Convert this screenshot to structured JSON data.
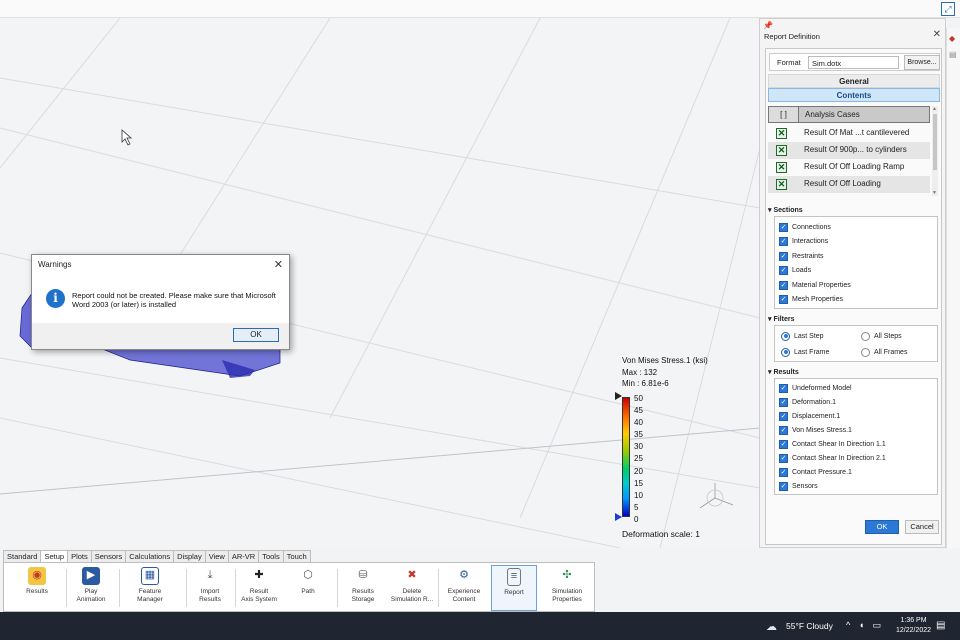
{
  "viewport": {
    "legend": {
      "title": "Von Mises Stress.1 (ksi)",
      "max_label": "Max : 132",
      "min_label": "Min : 6.81e-6",
      "ticks": [
        "50",
        "45",
        "40",
        "35",
        "30",
        "25",
        "20",
        "15",
        "10",
        "5",
        "0"
      ],
      "deformation_scale": "Deformation scale: 1"
    }
  },
  "dialog": {
    "title": "Warnings",
    "message": "Report could not be created. Please make sure that Microsoft Word 2003 (or later) is installed",
    "ok_label": "OK",
    "close_glyph": "✕"
  },
  "panel": {
    "title": "Report Definition",
    "close_glyph": "✕",
    "format_label": "Format",
    "format_value": "Sim.dotx",
    "browse_label": "Browse...",
    "general_label": "General",
    "contents_label": "Contents",
    "contents_header_bracket": "[ ]",
    "contents_header": "Analysis Cases",
    "contents": [
      "Result Of Mat ...t cantilevered",
      "Result Of 900p... to cylinders",
      "Result Of Off Loading Ramp",
      "Result Of Off Loading"
    ],
    "sections_label": "▾ Sections",
    "sections": [
      "Connections",
      "Interactions",
      "Restraints",
      "Loads",
      "Material Properties",
      "Mesh Properties"
    ],
    "filters_label": "▾ Filters",
    "filters": {
      "last_step": "Last Step",
      "all_steps": "All Steps",
      "last_frame": "Last Frame",
      "all_frames": "All Frames"
    },
    "results_label": "▾ Results",
    "results": [
      "Undeformed Model",
      "Deformation.1",
      "Displacement.1",
      "Von Mises Stress.1",
      "Contact Shear In Direction 1.1",
      "Contact Shear In Direction 2.1",
      "Contact Pressure.1",
      "Sensors"
    ],
    "ok_label": "OK",
    "cancel_label": "Cancel"
  },
  "toolbar": {
    "tabs": [
      "Standard",
      "Setup",
      "Plots",
      "Sensors",
      "Calculations",
      "Display",
      "View",
      "AR-VR",
      "Tools",
      "Touch"
    ],
    "tools": [
      {
        "line1": "Results",
        "line2": "",
        "icon": "results-icon"
      },
      {
        "line1": "Play",
        "line2": "Animation",
        "icon": "animation-icon"
      },
      {
        "line1": "Feature",
        "line2": "Manager",
        "icon": "feature-manager-icon"
      },
      {
        "line1": "Import",
        "line2": "Results",
        "icon": "import-icon"
      },
      {
        "line1": "Result",
        "line2": "Axis System",
        "icon": "axis-icon"
      },
      {
        "line1": "Path",
        "line2": "",
        "icon": "path-icon"
      },
      {
        "line1": "Results",
        "line2": "Storage",
        "icon": "storage-icon"
      },
      {
        "line1": "Delete",
        "line2": "Simulation R...",
        "icon": "delete-icon"
      },
      {
        "line1": "Experience",
        "line2": "Content",
        "icon": "experience-icon"
      },
      {
        "line1": "Report",
        "line2": "",
        "icon": "report-icon"
      },
      {
        "line1": "Simulation",
        "line2": "Properties",
        "icon": "properties-icon"
      }
    ]
  },
  "taskbar": {
    "weather": "55°F  Cloudy",
    "time": "1:36 PM",
    "date": "12/22/2022"
  }
}
